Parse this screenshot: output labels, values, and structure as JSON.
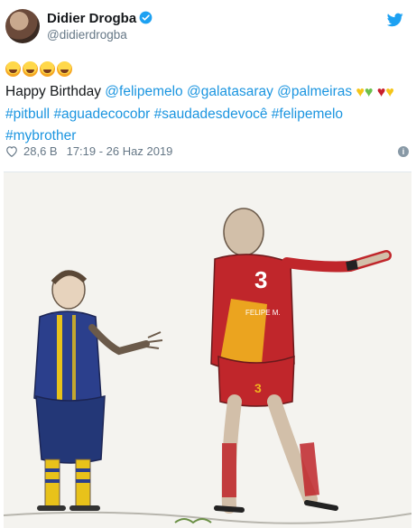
{
  "author": {
    "name": "Didier Drogba",
    "handle": "@didierdrogba"
  },
  "icons": {
    "verified": "verified-badge-icon",
    "brand": "twitter-bird-icon",
    "like": "heart-outline-icon",
    "info": "info-icon"
  },
  "tweet": {
    "emoji_line": "🤣🤣🤣🤣",
    "birthday": "Happy Birthday ",
    "mention_1": "@felipemelo",
    "mention_2": "@galatasaray",
    "mention_3": "@palmeiras",
    "hashtag_1": "#pitbull",
    "hashtag_2": "#aguadecocobr",
    "hashtag_3": "#saudadesdevocê",
    "hashtag_4": "#felipemelo",
    "hashtag_5": "#mybrother"
  },
  "meta": {
    "likes": "28,6 B",
    "timestamp": "17:19 - 26 Haz 2019"
  },
  "media": {
    "description_colors": {
      "fenerbahce_blue": "#2b3f8c",
      "fenerbahce_yellow": "#e8c21a",
      "galatasaray_red": "#c0262b",
      "galatasaray_yellow": "#f0b21e"
    },
    "shirt_number": "3",
    "shirt_text": "FELIPE M."
  },
  "colors": {
    "link": "#1b95e0",
    "secondary": "#657786",
    "twitter": "#1da1f2"
  }
}
